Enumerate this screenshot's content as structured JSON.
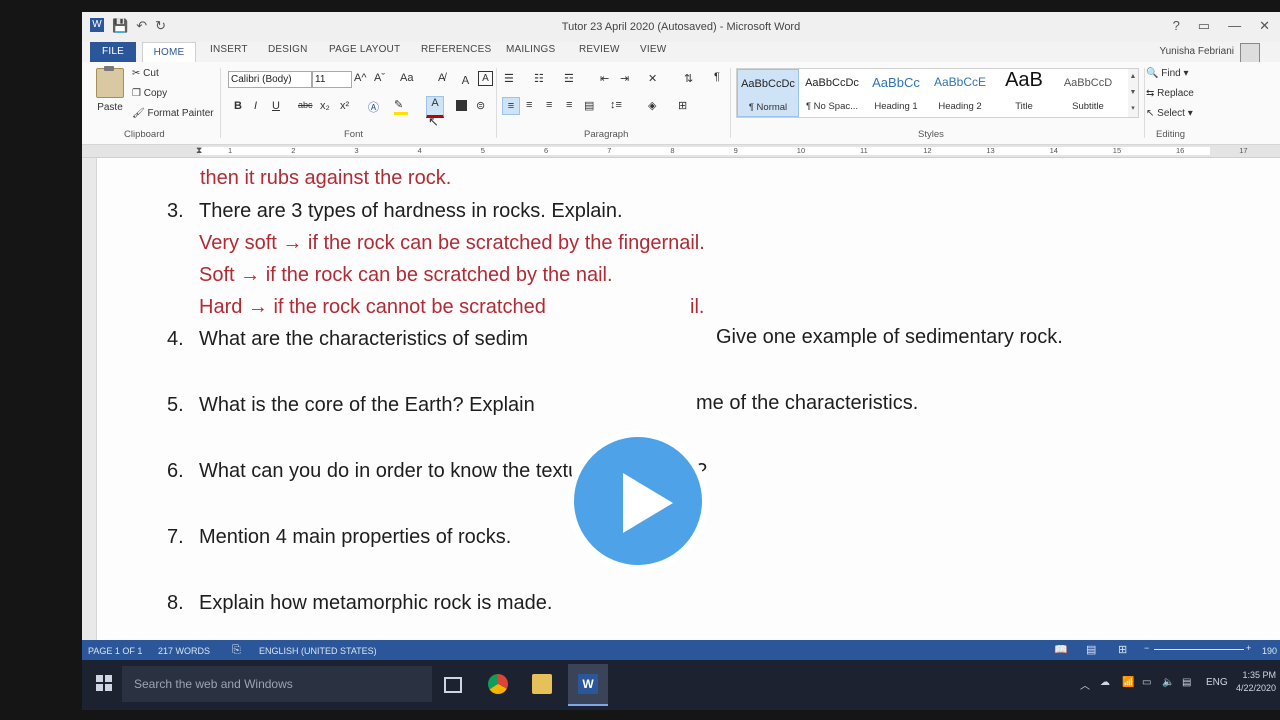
{
  "window": {
    "title": "Tutor 23 April 2020 (Autosaved) - Microsoft Word",
    "help": "?",
    "restore": "▭",
    "minimize": "—",
    "close": "✕"
  },
  "qat": {
    "save": "💾",
    "undo": "↶",
    "redo": "↻"
  },
  "tabs": [
    "FILE",
    "HOME",
    "INSERT",
    "DESIGN",
    "PAGE LAYOUT",
    "REFERENCES",
    "MAILINGS",
    "REVIEW",
    "VIEW"
  ],
  "user": "Yunisha Febriani",
  "ribbon": {
    "clipboard": {
      "paste": "Paste",
      "cut": "Cut",
      "copy": "Copy",
      "format_painter": "Format Painter",
      "label": "Clipboard"
    },
    "font": {
      "name": "Calibri (Body)",
      "size": "11",
      "label": "Font",
      "bold": "B",
      "italic": "I",
      "underline": "U",
      "strike": "abc",
      "sub": "x₂",
      "sup": "x²",
      "grow": "A^",
      "shrink": "Aˇ",
      "case": "Aa",
      "clear": "A",
      "highlight_color": "#ffe000",
      "font_color": "#c00000"
    },
    "paragraph": {
      "label": "Paragraph",
      "pilcrow": "¶"
    },
    "styles": {
      "label": "Styles",
      "items": [
        {
          "preview": "AaBbCcDc",
          "name": "¶ Normal"
        },
        {
          "preview": "AaBbCcDc",
          "name": "¶ No Spac..."
        },
        {
          "preview": "AaBbCc",
          "name": "Heading 1"
        },
        {
          "preview": "AaBbCcE",
          "name": "Heading 2"
        },
        {
          "preview": "AaB",
          "name": "Title"
        },
        {
          "preview": "AaBbCcD",
          "name": "Subtitle"
        }
      ]
    },
    "editing": {
      "label": "Editing",
      "find": "Find",
      "replace": "Replace",
      "select": "Select"
    }
  },
  "ruler": {
    "ticks": [
      "1",
      "2",
      "3",
      "4",
      "5",
      "6",
      "7",
      "8",
      "9",
      "10",
      "11",
      "12",
      "13",
      "14",
      "15",
      "16",
      "17"
    ]
  },
  "document": {
    "continued": "then it rubs against the rock.",
    "q3": {
      "num": "3.",
      "text": "There are 3 types of hardness in rocks. Explain."
    },
    "answers": [
      "Very soft → if the rock can be scratched by the fingernail.",
      "Soft → if the rock can be scratched by the nail.",
      "Hard → if the rock cannot be scratched",
      "il."
    ],
    "q4": {
      "num": "4.",
      "text_a": "What are the characteristics of sedim",
      "text_b": "Give one example of sedimentary rock."
    },
    "q5": {
      "num": "5.",
      "text_a": "What is the core of the Earth? Explain",
      "text_b": "me of the characteristics."
    },
    "q6": {
      "num": "6.",
      "text": "What can you do in order to know the texture of the rock?"
    },
    "q7": {
      "num": "7.",
      "text": "Mention 4 main properties of rocks."
    },
    "q8": {
      "num": "8.",
      "text": "Explain how metamorphic rock is made."
    }
  },
  "status": {
    "page": "PAGE 1 OF 1",
    "words": "217 WORDS",
    "language": "ENGLISH (UNITED STATES)",
    "zoom": "190"
  },
  "taskbar": {
    "search_placeholder": "Search the web and Windows",
    "lang": "ENG",
    "time": "1:35 PM",
    "date": "4/22/2020",
    "word_label": "W"
  }
}
